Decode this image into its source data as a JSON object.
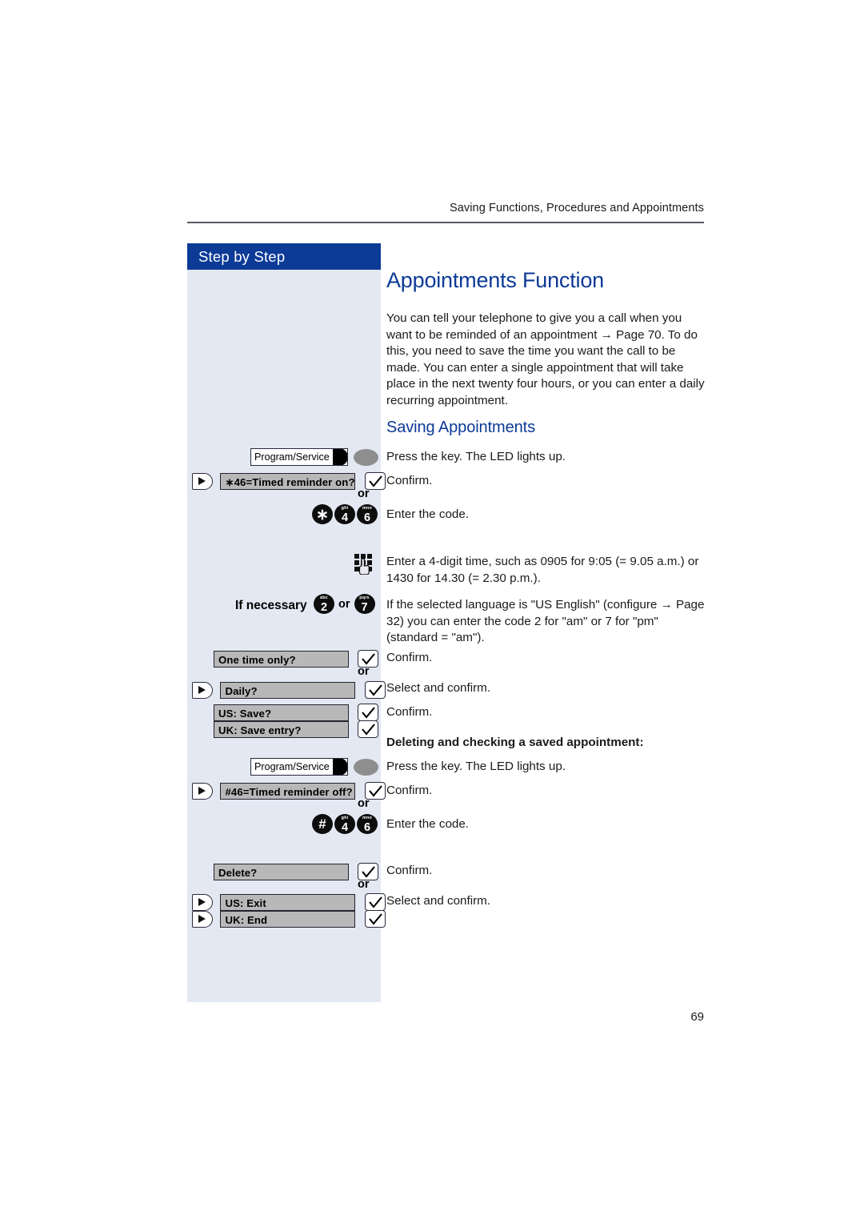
{
  "header": {
    "running_title": "Saving Functions, Procedures and Appointments"
  },
  "sidebar": {
    "banner_label": "Step by Step"
  },
  "main": {
    "title": "Appointments Function",
    "intro_paragraph": "You can tell your telephone to give you a call when you want to be reminded of an appointment → Page 70. To do this, you need to save the time you want the call to be made. You can enter a single appointment that will take place in the next twenty four hours, or you can enter a daily recurring appointment.",
    "section_saving_title": "Saving Appointments",
    "subheading_deleting": "Deleting and checking a saved appointment:"
  },
  "instructions": {
    "press_key_led": "Press the key. The LED lights up.",
    "confirm": "Confirm.",
    "enter_code": "Enter the code.",
    "enter_time": "Enter a 4-digit time, such as 0905 for 9:05 (= 9.05 a.m.) or 1430 for 14.30 (= 2.30 p.m.).",
    "am_pm_note": "If the selected language is \"US English\" (configure → Page 32) you can enter the code 2 for \"am\" or 7 for \"pm\" (standard = \"am\").",
    "select_and_confirm": "Select and confirm."
  },
  "keys": {
    "program_service_label": "Program/Service",
    "or_label": "or",
    "if_necessary_label": "If necessary",
    "or_inline_label": "or"
  },
  "prompts": {
    "timed_reminder_on": "46=Timed reminder on?",
    "timed_reminder_on_prefix": "∗",
    "one_time_only": "One time only?",
    "daily": "Daily?",
    "us_save": "US: Save?",
    "uk_save_entry": "UK: Save entry?",
    "timed_reminder_off": "#46=Timed reminder off?",
    "delete": "Delete?",
    "us_exit": "US: Exit",
    "uk_end": "UK: End"
  },
  "keypad": {
    "star": {
      "glyph": "∗",
      "letters": ""
    },
    "hash": {
      "glyph": "#",
      "letters": ""
    },
    "four": {
      "num": "4",
      "letters": "ghi"
    },
    "six": {
      "num": "6",
      "letters": "mno"
    },
    "two": {
      "num": "2",
      "letters": "abc"
    },
    "seven": {
      "num": "7",
      "letters": "pqrs"
    }
  },
  "footer": {
    "page_number": "69"
  },
  "colors": {
    "accent_blue": "#0c3a97",
    "sidebar_bg": "#e3e8f3",
    "prompt_grey": "#b8b8b8",
    "led_grey": "#8e8e8e"
  }
}
